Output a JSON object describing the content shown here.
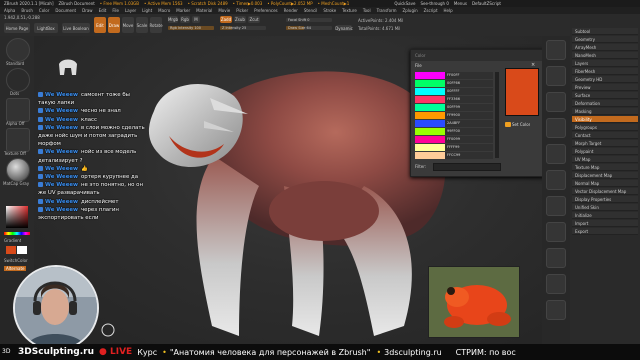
{
  "titlebar": {
    "app": "ZBrush 2020.1.1 [Micah]",
    "doc": "ZBrush Document",
    "free_mem": "• Free Mem 1.03GB",
    "active_mem": "• Active Mem 1563",
    "scratch": "• Scratch Disk 2489",
    "timer": "• Timer▶0.003",
    "poly": "• PolyCount▶2.052 MP",
    "mesh": "• MeshCount▶1",
    "quicksave": "QuickSave",
    "see_through": "See-through 0",
    "menus": "Menus",
    "script": "DefaultZScript"
  },
  "menubar": [
    "Alpha",
    "Brush",
    "Color",
    "Document",
    "Draw",
    "Edit",
    "File",
    "Layer",
    "Light",
    "Macro",
    "Marker",
    "Material",
    "Movie",
    "Picker",
    "Preferences",
    "Render",
    "Stencil",
    "Stroke",
    "Texture",
    "Tool",
    "Transform",
    "Zplugin",
    "Zscript",
    "Help"
  ],
  "toolbar": {
    "coords": "1.942,0.51,-0.288",
    "homepage": "Home Page",
    "lightbox": "LightBox",
    "liveboolean": "Live Boolean",
    "edit": "Edit",
    "draw": "Draw",
    "move": "Move",
    "scale": "Scale",
    "rotate": "Rotate",
    "mrgb": "Mrgb",
    "rgb": "Rgb",
    "m": "M",
    "rgb_intensity": "Rgb Intensity 100",
    "zadd": "Zadd",
    "zsub": "Zsub",
    "zcut": "Zcut",
    "z_intensity": "Z Intensity 25",
    "focal_shift": "Focal Shift 0",
    "draw_size": "Draw Size 64",
    "dynamic": "Dynamic",
    "active_points": "ActivePoints: 2.404 Mil",
    "total_points": "TotalPoints: 4.671 Mil"
  },
  "leftshelf": {
    "labels": [
      "Standard",
      "Dots",
      "Alpha Off",
      "Texture Off",
      "MatCap Gray",
      "Gradient",
      "SwitchColor",
      "Alternate"
    ]
  },
  "chat": {
    "messages": [
      {
        "name": "We Weeew",
        "text": "самсент тоже бы такую лапки"
      },
      {
        "name": "We Weeew",
        "text": "чесно не знал"
      },
      {
        "name": "We Weeew",
        "text": "класс"
      },
      {
        "name": "We Weeew",
        "text": "в слои можно сделать даже нойс шум и потом заградить морфом"
      },
      {
        "name": "We Weeew",
        "text": "нойс из все модель детализирует ?"
      },
      {
        "name": "We Weeew",
        "text": "👍"
      },
      {
        "name": "We Weeew",
        "text": "ортеря курупнее да"
      },
      {
        "name": "We Weeew",
        "text": "не это понятно, но он же UV разварачивать"
      },
      {
        "name": "We Weeew",
        "text": "дисплейсмет"
      },
      {
        "name": "We Weeew",
        "text": "через плагин экспортировать если"
      }
    ]
  },
  "colorwin": {
    "header": "Color",
    "file_label": "File",
    "swatches": [
      {
        "color": "#ff00ff",
        "hex": "FF00FF"
      },
      {
        "color": "#00ff66",
        "hex": "00FF66"
      },
      {
        "color": "#00ffff",
        "hex": "00FFFF"
      },
      {
        "color": "#ff3366",
        "hex": "FF3366"
      },
      {
        "color": "#00ff99",
        "hex": "00FF99"
      },
      {
        "color": "#ff9900",
        "hex": "FF9900"
      },
      {
        "color": "#2a4bff",
        "hex": "2A4BFF"
      },
      {
        "color": "#99ff00",
        "hex": "99FF00"
      },
      {
        "color": "#ff0099",
        "hex": "FF0099"
      },
      {
        "color": "#ffff99",
        "hex": "FFFF99"
      },
      {
        "color": "#ffcc99",
        "hex": "FFCC99"
      }
    ],
    "big_color": "#d94a1a",
    "set_color": "Set Color",
    "filter": "Filter:"
  },
  "rightpanel": {
    "items": [
      "Subtool",
      "Geometry",
      "ArrayMesh",
      "NanoMesh",
      "Layers",
      "FiberMesh",
      "Geometry HD",
      "Preview",
      "Surface",
      "Deformation",
      "Masking",
      "Visibility",
      "Polygroups",
      "Contact",
      "Morph Target",
      "Polypaint",
      "UV Map",
      "Texture Map",
      "Displacement Map",
      "Normal Map",
      "Vector Displacement Map",
      "Display Properties",
      "Unified Skin",
      "Initialize",
      "Import",
      "Export"
    ],
    "highlight_index": 11
  },
  "bottombar": {
    "brand": "3DSculpting.ru",
    "live": "LIVE",
    "course": "Курс",
    "title": "\"Анатомия человека для персонажей в Zbrush\"",
    "site": "3dsculpting.ru",
    "stream": "СТРИМ: по вос"
  },
  "colors": {
    "accent": "#f0a020",
    "highlight": "#c26a1e",
    "chat_name": "#3b8ff0",
    "live_red": "#e02020"
  }
}
